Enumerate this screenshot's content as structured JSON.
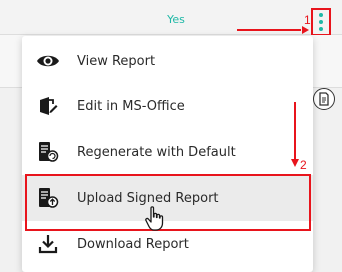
{
  "table": {
    "yes_value": "Yes"
  },
  "menu": {
    "items": [
      {
        "label": "View Report",
        "icon": "eye-icon"
      },
      {
        "label": "Edit in MS-Office",
        "icon": "office-edit-icon"
      },
      {
        "label": "Regenerate with Default",
        "icon": "regenerate-icon"
      },
      {
        "label": "Upload Signed Report",
        "icon": "upload-signed-icon"
      },
      {
        "label": "Download Report",
        "icon": "download-icon"
      }
    ]
  },
  "annotations": {
    "step_1": "1",
    "step_2": "2"
  },
  "colors": {
    "accent": "#1fb8a6",
    "annotation": "#e8141c",
    "hover_bg": "#ebebeb"
  }
}
